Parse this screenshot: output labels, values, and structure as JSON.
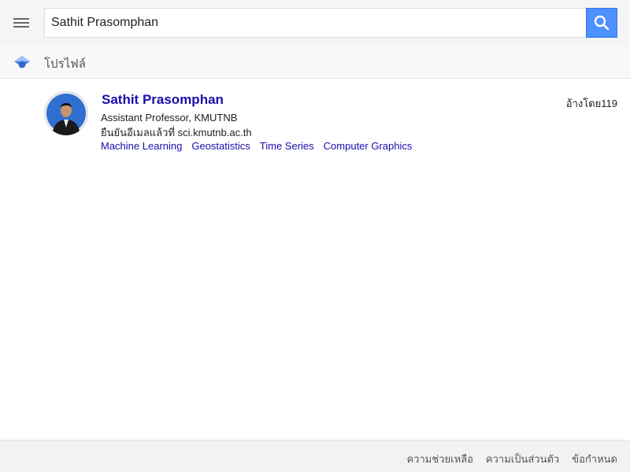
{
  "search": {
    "value": "Sathit Prasomphan"
  },
  "tabs": {
    "profiles_label": "โปรไฟล์"
  },
  "profile": {
    "name": "Sathit Prasomphan",
    "affiliation": "Assistant Professor, KMUTNB",
    "verified_email": "ยืนยันอีเมลแล้วที่ sci.kmutnb.ac.th",
    "cited_by": "อ้างโดย119",
    "interests": [
      "Machine Learning",
      "Geostatistics",
      "Time Series",
      "Computer Graphics"
    ]
  },
  "footer": {
    "links": [
      "ความช่วยเหลือ",
      "ความเป็นส่วนตัว",
      "ข้อกำหนด"
    ]
  },
  "colors": {
    "accent": "#4d90fe",
    "link": "#1a0dab"
  },
  "icons": {
    "menu": "hamburger-icon",
    "search": "search-icon",
    "logo": "scholar-logo-icon"
  }
}
